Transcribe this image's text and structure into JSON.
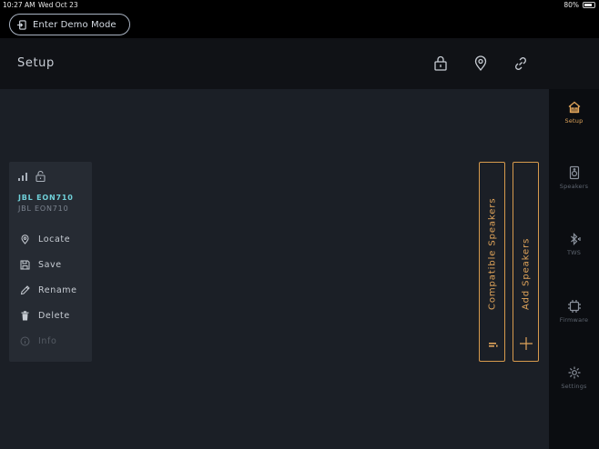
{
  "status_bar": {
    "time": "10:27 AM",
    "date": "Wed Oct 23",
    "battery": "80%",
    "battery_level": 0.8
  },
  "demo_button": {
    "label": "Enter Demo Mode"
  },
  "header": {
    "title": "Setup",
    "icons": [
      "lock-icon",
      "location-icon",
      "link-icon"
    ]
  },
  "device_card": {
    "name": "JBL EON710",
    "model": "JBL EON710",
    "menu": [
      {
        "label": "Locate",
        "icon": "location-pin-icon"
      },
      {
        "label": "Save",
        "icon": "save-icon"
      },
      {
        "label": "Rename",
        "icon": "pencil-icon"
      },
      {
        "label": "Delete",
        "icon": "trash-icon"
      },
      {
        "label": "Info",
        "icon": "info-icon",
        "disabled": true
      }
    ]
  },
  "actions": {
    "compatible": {
      "label": "Compatible Speakers",
      "icon": "info-icon"
    },
    "add": {
      "label": "Add Speakers",
      "icon": "plus-icon"
    }
  },
  "sidebar": {
    "items": [
      {
        "label": "Setup",
        "icon": "home-icon",
        "active": true
      },
      {
        "label": "Speakers",
        "icon": "speaker-icon"
      },
      {
        "label": "TWS",
        "icon": "bluetooth-icon"
      },
      {
        "label": "Firmware",
        "icon": "chip-icon"
      },
      {
        "label": "Settings",
        "icon": "gear-icon"
      }
    ]
  },
  "colors": {
    "accent": "#e0a45a",
    "device_name": "#6fd0d9",
    "background": "#1b1f26",
    "card": "#262b33"
  }
}
